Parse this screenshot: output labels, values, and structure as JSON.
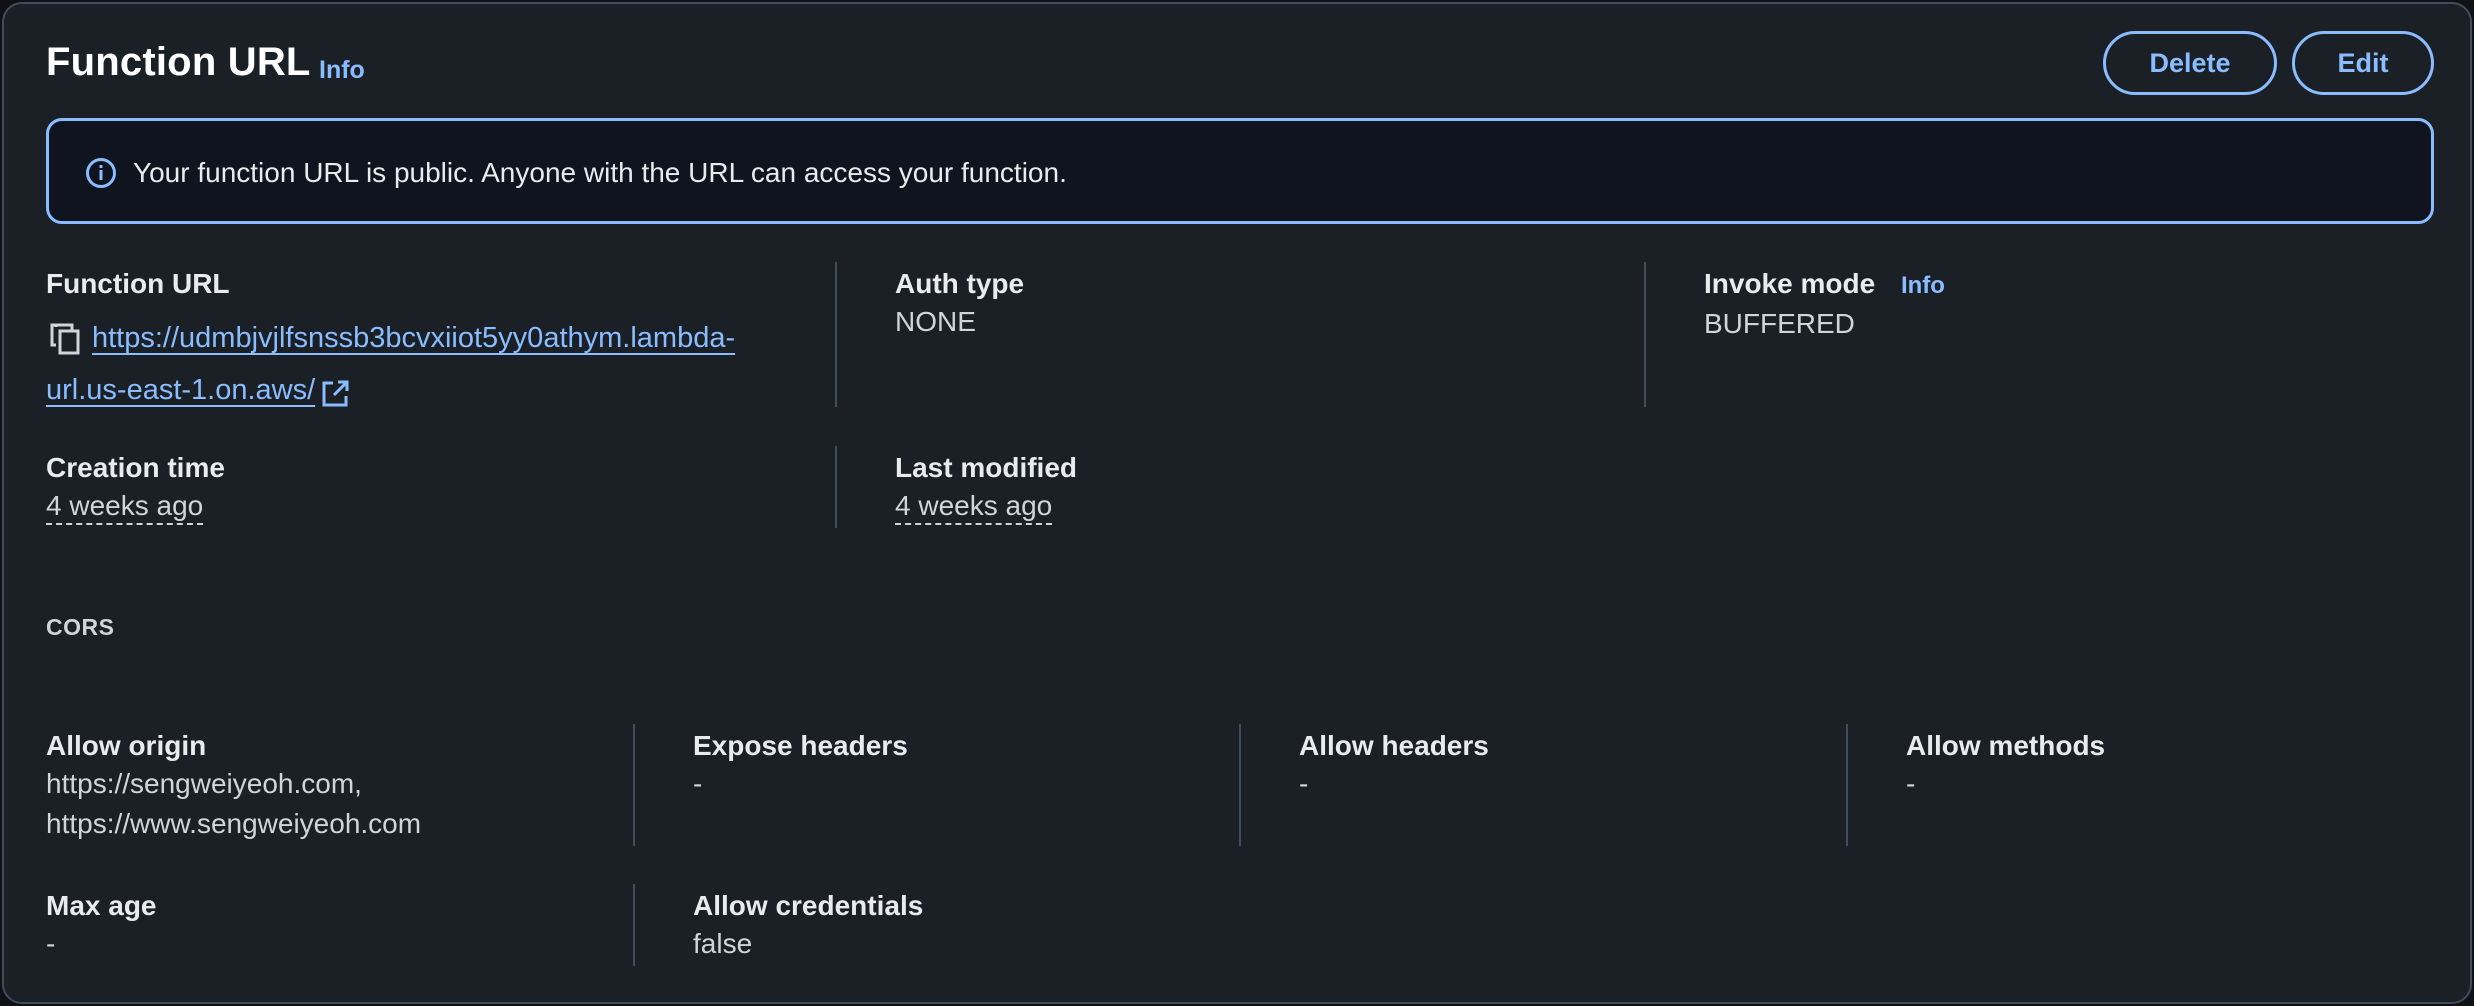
{
  "header": {
    "title": "Function URL",
    "info_label": "Info",
    "delete_label": "Delete",
    "edit_label": "Edit"
  },
  "alert": {
    "text": "Your function URL is public. Anyone with the URL can access your function."
  },
  "config": {
    "function_url_label": "Function URL",
    "function_url_value": "https://udmbjvjlfsnssb3bcvxiiot5yy0athym.lambda-url.us-east-1.on.aws/",
    "auth_type_label": "Auth type",
    "auth_type_value": "NONE",
    "invoke_mode_label": "Invoke mode",
    "invoke_mode_info": "Info",
    "invoke_mode_value": "BUFFERED",
    "creation_time_label": "Creation time",
    "creation_time_value": "4 weeks ago",
    "last_modified_label": "Last modified",
    "last_modified_value": "4 weeks ago"
  },
  "cors": {
    "section_label": "CORS",
    "allow_origin_label": "Allow origin",
    "allow_origin_values": [
      "https://sengweiyeoh.com,",
      "https://www.sengweiyeoh.com"
    ],
    "expose_headers_label": "Expose headers",
    "expose_headers_value": "-",
    "allow_headers_label": "Allow headers",
    "allow_headers_value": "-",
    "allow_methods_label": "Allow methods",
    "allow_methods_value": "-",
    "max_age_label": "Max age",
    "max_age_value": "-",
    "allow_credentials_label": "Allow credentials",
    "allow_credentials_value": "false"
  },
  "icons": {
    "alert": "info-circle-icon",
    "copy": "copy-icon",
    "external": "external-link-icon"
  },
  "colors": {
    "accent": "#89bdff",
    "background": "#1b1f26",
    "alert_background": "#0f141e",
    "border": "#414d5c"
  }
}
